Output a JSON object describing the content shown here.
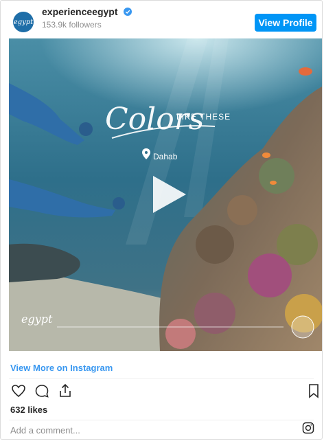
{
  "header": {
    "username": "experienceegypt",
    "followers": "153.9k followers",
    "view_profile": "View Profile",
    "avatar_text": "egypt"
  },
  "media": {
    "overlay_title": "Colors",
    "overlay_subtitle": "LIKE THESE",
    "location": "Dahab",
    "brand_mark": "egypt"
  },
  "footer": {
    "view_more": "View More on Instagram",
    "likes": "632 likes",
    "comment_placeholder": "Add a comment..."
  },
  "colors": {
    "accent": "#0095f6",
    "link": "#3897f0"
  }
}
